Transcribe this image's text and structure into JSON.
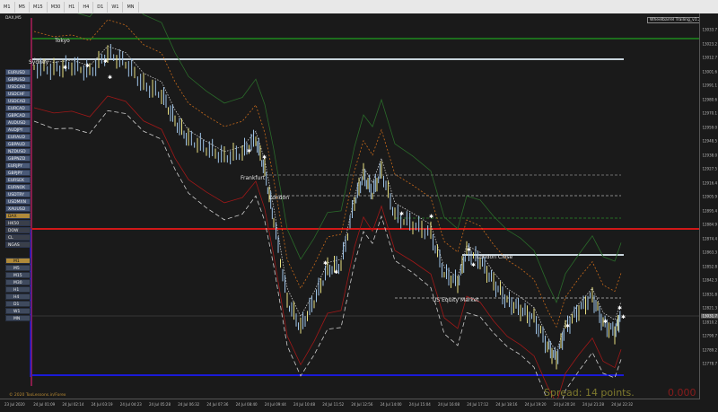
{
  "toolbar": {
    "timeframes": [
      "M1",
      "M5",
      "M15",
      "M30",
      "H1",
      "H4",
      "D1",
      "W1",
      "MN"
    ]
  },
  "chart": {
    "symbol_tag": "DAX,M5",
    "indicator_name": "Wheelbarrel Trailing_v1.2",
    "spread_text": "Spread: 14 points.",
    "red_value": "0.000",
    "copyright": "© 2020 TooLessons.in/Forex",
    "current_price": "13031.7"
  },
  "symbols": [
    {
      "label": "EURUSD",
      "style": "blue"
    },
    {
      "label": "GBPUSD",
      "style": "blue"
    },
    {
      "label": "USDCAD",
      "style": "blue"
    },
    {
      "label": "USDCHF",
      "style": "blue"
    },
    {
      "label": "USDCAD",
      "style": "blue"
    },
    {
      "label": "EURCAD",
      "style": "blue"
    },
    {
      "label": "GBPCAD",
      "style": "blue"
    },
    {
      "label": "AUDUSD",
      "style": "blue"
    },
    {
      "label": "AUDJPY",
      "style": "blue"
    },
    {
      "label": "EURAUD",
      "style": "blue"
    },
    {
      "label": "GBPAUD",
      "style": "blue"
    },
    {
      "label": "NZDUSD",
      "style": "blue"
    },
    {
      "label": "GBPNZD",
      "style": "blue"
    },
    {
      "label": "EURJPY",
      "style": "blue"
    },
    {
      "label": "GBPJPY",
      "style": "blue"
    },
    {
      "label": "EURSEK",
      "style": "blue"
    },
    {
      "label": "EURNOK",
      "style": "blue"
    },
    {
      "label": "USDTRY",
      "style": "blue"
    },
    {
      "label": "USDMXN",
      "style": "blue"
    },
    {
      "label": "XAUUSD",
      "style": "blue"
    },
    {
      "label": "DAX",
      "style": "gold"
    },
    {
      "label": "HK50",
      "style": "dark"
    },
    {
      "label": "DOW",
      "style": "dark"
    },
    {
      "label": "CL",
      "style": "dark"
    },
    {
      "label": "NGAS",
      "style": "dark"
    }
  ],
  "tf_panel": [
    {
      "label": "M1",
      "style": "gold"
    },
    {
      "label": "M5",
      "style": "blue"
    },
    {
      "label": "M15",
      "style": "blue"
    },
    {
      "label": "M30",
      "style": "blue"
    },
    {
      "label": "H1",
      "style": "blue"
    },
    {
      "label": "H4",
      "style": "blue"
    },
    {
      "label": "D1",
      "style": "blue"
    },
    {
      "label": "W1",
      "style": "blue"
    },
    {
      "label": "MN",
      "style": "blue"
    }
  ],
  "sessions": {
    "tokyo": "Tokyo",
    "sydney": "Sydney",
    "frankfurt": "Frankfurt",
    "london": "London",
    "london_close": "London Close",
    "us_equity": "US Equity Market"
  },
  "price_axis": [
    "13033.7",
    "13023.2",
    "13012.7",
    "13001.6",
    "12991.1",
    "12980.6",
    "12970.1",
    "12959.0",
    "12948.5",
    "12938.0",
    "12927.5",
    "12916.4",
    "12905.9",
    "12895.4",
    "12884.9",
    "12874.4",
    "12863.3",
    "12852.8",
    "12842.3",
    "12831.8",
    "12821.3",
    "12810.2",
    "12799.7",
    "12789.2",
    "12778.7"
  ],
  "time_axis": [
    "23 Jul 2020",
    "24 Jul 01:09",
    "24 Jul 02:14",
    "24 Jul 03:19",
    "24 Jul 04:23",
    "24 Jul 05:28",
    "24 Jul 06:32",
    "24 Jul 07:36",
    "24 Jul 08:40",
    "24 Jul 09:44",
    "24 Jul 10:48",
    "24 Jul 11:52",
    "24 Jul 12:56",
    "24 Jul 14:00",
    "24 Jul 15:04",
    "24 Jul 16:08",
    "24 Jul 17:12",
    "24 Jul 18:16",
    "24 Jul 19:20",
    "24 Jul 20:24",
    "24 Jul 21:28",
    "24 Jul 22:32"
  ],
  "colors": {
    "green_level": "#1e8a1e",
    "red_level": "#d01818",
    "blue_level": "#1a1ad8",
    "white_level": "#c8d4dc",
    "candle_bull": "#9fc4e8",
    "candle_bear": "#e8e080",
    "band_orange": "#c86a1a",
    "band_red": "#a01818",
    "band_white": "#cccccc",
    "band_green": "#2a6a2a"
  }
}
